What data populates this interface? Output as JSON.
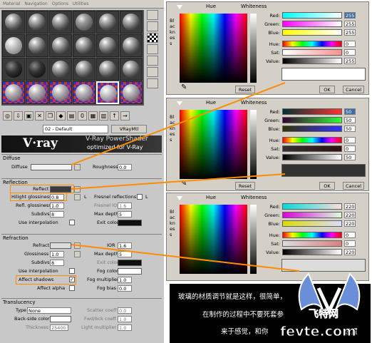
{
  "menu": [
    "Material",
    "Navigation",
    "Options",
    "Utilities"
  ],
  "material": {
    "name": "02 - Default",
    "type": "VRayMtl"
  },
  "banner": {
    "logo": "V·ray",
    "subtitle": "V-Ray PowerShader",
    "optimized": "optimized for V-Ray"
  },
  "diffuse": {
    "title": "Diffuse",
    "diffuse_label": "Diffuse",
    "roughness_label": "Roughness",
    "roughness_value": "0.0",
    "diffuse_color": "#f2f2f2"
  },
  "reflection": {
    "title": "Reflection",
    "reflect_label": "Reflect",
    "reflect_color": "#3c3c3c",
    "hilight_label": "Hilight glossiness",
    "hilight_value": "0.8",
    "l_label": "L",
    "fresnel_label": "Fresnel reflections",
    "fresnel_ior_label": "Fresnel IOR",
    "fresnel_ior_value": "1.6",
    "refl_gloss_label": "Refl. glossiness",
    "refl_gloss_value": "1.0",
    "subdivs_label": "Subdivs",
    "subdivs_value": "8",
    "max_depth_label": "Max depth",
    "max_depth_value": "5",
    "use_interp_label": "Use interpolation",
    "exit_color_label": "Exit color",
    "exit_color": "#101010"
  },
  "refraction": {
    "title": "Refraction",
    "refract_label": "Refract",
    "refract_color": "#dcdcdc",
    "ior_label": "IOR",
    "ior_value": "1.6",
    "gloss_label": "Glossiness",
    "gloss_value": "1.0",
    "max_depth_label": "Max depth",
    "max_depth_value": "5",
    "subdivs_label": "Subdivs",
    "subdivs_value": "8",
    "exit_color_label": "Exit color",
    "exit_color": "#101010",
    "use_interp_label": "Use interpolation",
    "fog_color_label": "Fog color",
    "fog_color": "#ffffff",
    "affect_shadows_label": "Affect shadows",
    "affect_shadows_check": "✓",
    "fog_mult_label": "Fog multiplier",
    "fog_mult_value": "1.0",
    "affect_alpha_label": "Affect alpha",
    "fog_bias_label": "Fog bias",
    "fog_bias_value": "0.0"
  },
  "translucency": {
    "title": "Translucency",
    "type_label": "Type",
    "type_value": "None",
    "scatter_label": "Scatter coeff",
    "scatter_value": "0.0",
    "backside_label": "Back-side color",
    "fwd_label": "Fwd/bck coeff",
    "fwd_value": "1.0",
    "thickness_label": "Thickness",
    "thickness_value": "25400",
    "light_mult_label": "Light multiplier",
    "light_mult_value": "1.0"
  },
  "pickers": [
    {
      "hue_label": "Hue",
      "whiteness_label": "Whiteness",
      "blackness_label": "Blackness",
      "rows": [
        {
          "label": "Red:",
          "value": "255",
          "bar": "linear-gradient(90deg,#00ffff,#ffffff)"
        },
        {
          "label": "Green:",
          "value": "255",
          "bar": "linear-gradient(90deg,#ff00ff,#ffffff)"
        },
        {
          "label": "Blue:",
          "value": "255",
          "bar": "linear-gradient(90deg,#ffff00,#ffffff)"
        },
        {
          "label": "Hue:",
          "value": "0",
          "bar": "linear-gradient(90deg,#f00,#ff0,#0f0,#0ff,#00f,#f0f,#f00)"
        },
        {
          "label": "Sat:",
          "value": "0",
          "bar": "linear-gradient(90deg,#ffffff,#ff9090)"
        },
        {
          "label": "Value:",
          "value": "255",
          "bar": "linear-gradient(90deg,#000000,#ffffff)"
        }
      ],
      "preview_color": "#ffffff",
      "reset_label": "Reset",
      "ok_label": "OK",
      "cancel_label": "Cancel"
    },
    {
      "hue_label": "Hue",
      "whiteness_label": "Whiteness",
      "blackness_label": "Blackness",
      "rows": [
        {
          "label": "Red:",
          "value": "50",
          "bar": "linear-gradient(90deg,#003232,#ff3232)"
        },
        {
          "label": "Green:",
          "value": "50",
          "bar": "linear-gradient(90deg,#320032,#32ff32)"
        },
        {
          "label": "Blue:",
          "value": "50",
          "bar": "linear-gradient(90deg,#323200,#3232ff)"
        },
        {
          "label": "Hue:",
          "value": "0",
          "bar": "linear-gradient(90deg,#f00,#ff0,#0f0,#0ff,#00f,#f0f,#f00)"
        },
        {
          "label": "Sat:",
          "value": "0",
          "bar": "linear-gradient(90deg,#323232,#321010)"
        },
        {
          "label": "Value:",
          "value": "50",
          "bar": "linear-gradient(90deg,#000000,#ffffff)"
        }
      ],
      "preview_color": "#323232",
      "reset_label": "Reset",
      "ok_label": "OK",
      "cancel_label": "Cancel"
    },
    {
      "hue_label": "Hue",
      "whiteness_label": "Whiteness",
      "blackness_label": "Blackness",
      "rows": [
        {
          "label": "Red:",
          "value": "220",
          "bar": "linear-gradient(90deg,#00dcdc,#ffdcdc)"
        },
        {
          "label": "Green:",
          "value": "220",
          "bar": "linear-gradient(90deg,#dc00dc,#dcffdc)"
        },
        {
          "label": "Blue:",
          "value": "220",
          "bar": "linear-gradient(90deg,#dcdc00,#dcdcff)"
        },
        {
          "label": "Hue:",
          "value": "0",
          "bar": "linear-gradient(90deg,#f00,#ff0,#0f0,#0ff,#00f,#f0f,#f00)"
        },
        {
          "label": "Sat:",
          "value": "0",
          "bar": "linear-gradient(90deg,#dcdcdc,#dc8080)"
        },
        {
          "label": "Value:",
          "value": "220",
          "bar": "linear-gradient(90deg,#000000,#ffffff)"
        }
      ],
      "preview_color": "#dcdcdc",
      "reset_label": "Reset",
      "ok_label": "OK",
      "cancel_label": "Cancel"
    }
  ],
  "caption": {
    "line1": "玻璃的材质调节就是这样，很简单，",
    "line1b": "杂，",
    "line2": "在制作的过程中不要死套参",
    "line3": "来于感觉，和你",
    "line3b": "设置"
  },
  "watermark": {
    "cn": "飞特网",
    "site": "fevte.com"
  },
  "accent": "#ff8c00"
}
